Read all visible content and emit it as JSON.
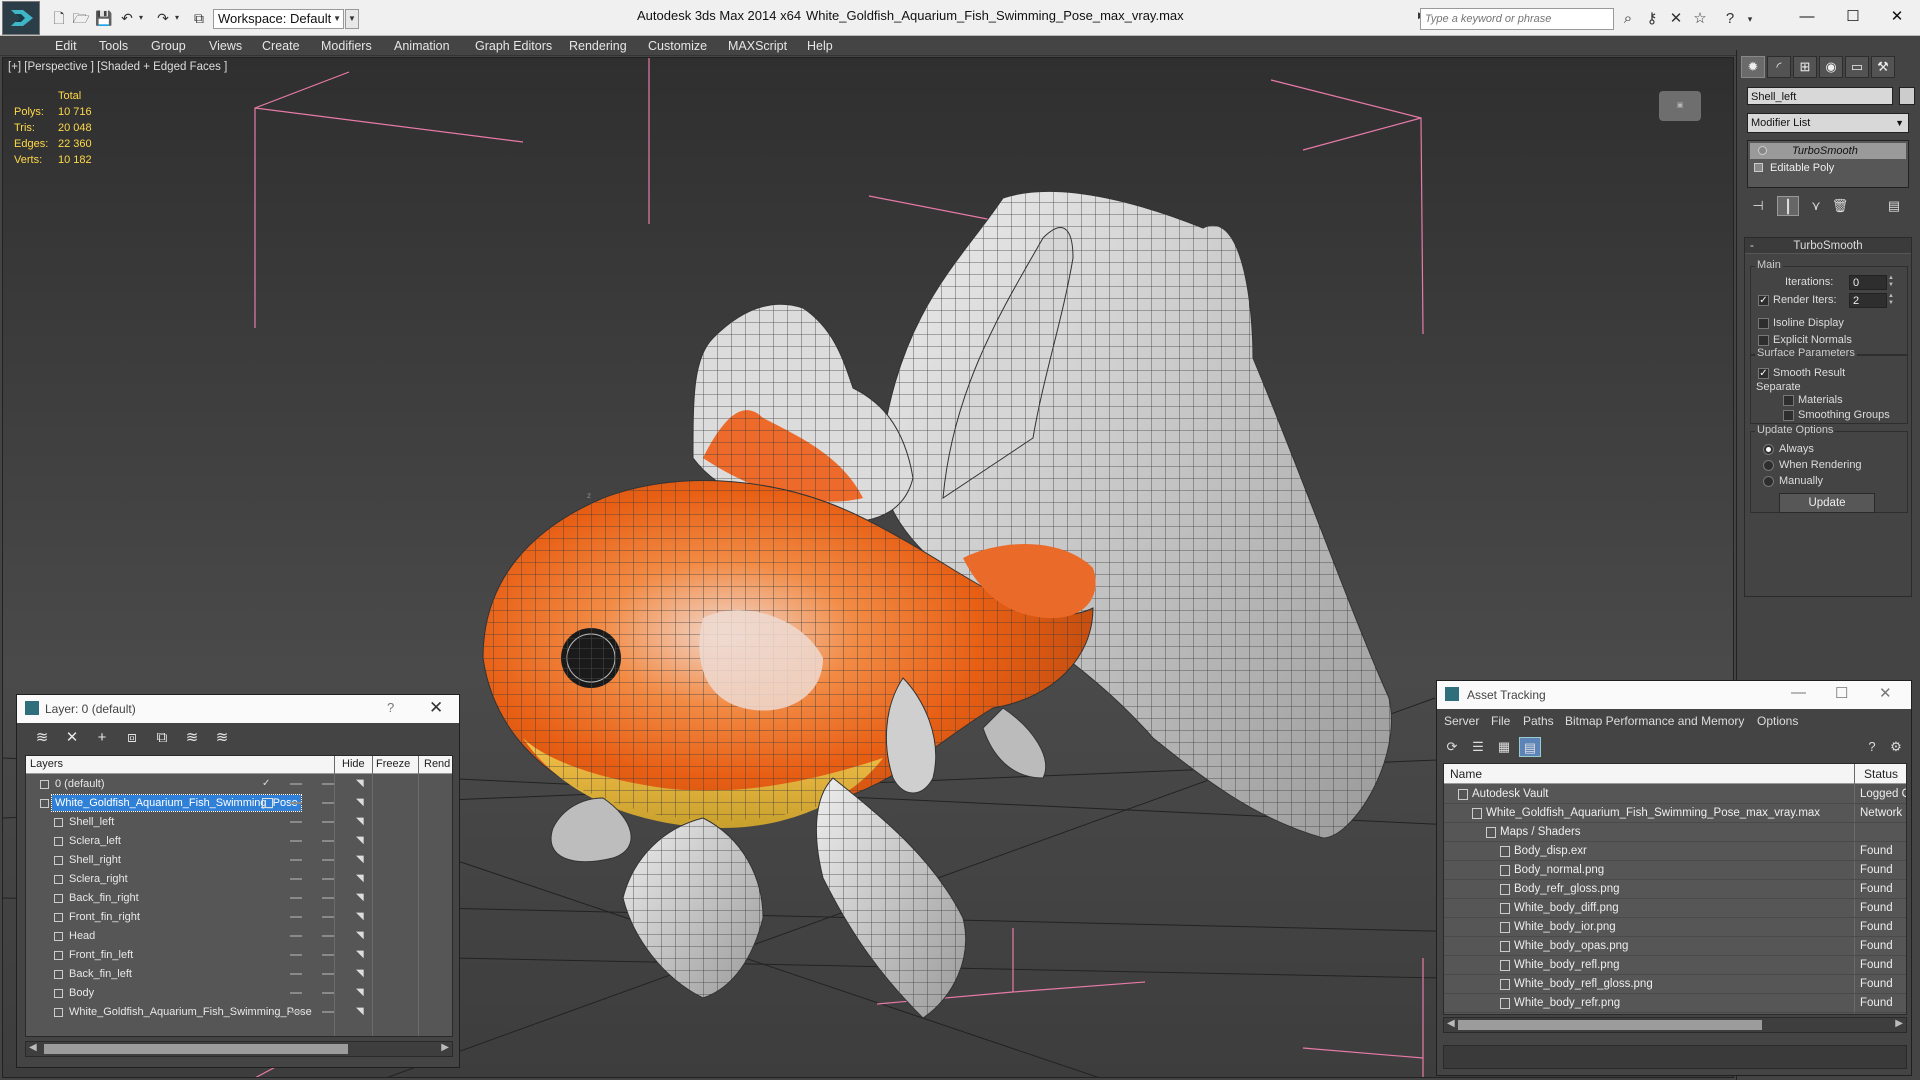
{
  "titlebar": {
    "workspace": "Workspace: Default",
    "app_title": "Autodesk 3ds Max  2014 x64",
    "file_title": "White_Goldfish_Aquarium_Fish_Swimming_Pose_max_vray.max",
    "search_placeholder": "Type a keyword or phrase"
  },
  "menu": [
    "Edit",
    "Tools",
    "Group",
    "Views",
    "Create",
    "Modifiers",
    "Animation",
    "Graph Editors",
    "Rendering",
    "Customize",
    "MAXScript",
    "Help"
  ],
  "viewport": {
    "label": "[+] [Perspective ] [Shaded + Edged Faces ]",
    "stats": {
      "total_label": "Total",
      "rows": [
        {
          "label": "Polys:",
          "value": "10 716"
        },
        {
          "label": "Tris:",
          "value": "20 048"
        },
        {
          "label": "Edges:",
          "value": "22 360"
        },
        {
          "label": "Verts:",
          "value": "10 182"
        }
      ]
    }
  },
  "command_panel": {
    "object_name": "Shell_left",
    "modifier_list": "Modifier List",
    "stack": [
      "TurboSmooth",
      "Editable Poly"
    ],
    "rollout_title": "TurboSmooth",
    "main_label": "Main",
    "iterations_label": "Iterations:",
    "iterations_value": "0",
    "render_iters_label": "Render Iters:",
    "render_iters_value": "2",
    "isoline_label": "Isoline Display",
    "explicit_normals_label": "Explicit Normals",
    "surface_params_label": "Surface Parameters",
    "smooth_result_label": "Smooth Result",
    "separate_label": "Separate",
    "materials_label": "Materials",
    "smoothing_groups_label": "Smoothing Groups",
    "update_options_label": "Update Options",
    "always_label": "Always",
    "when_rendering_label": "When Rendering",
    "manually_label": "Manually",
    "update_button": "Update"
  },
  "layer_dialog": {
    "title": "Layer: 0 (default)",
    "help": "?",
    "columns": {
      "layers": "Layers",
      "hide": "Hide",
      "freeze": "Freeze",
      "render": "Rend"
    },
    "rows": [
      {
        "name": "0 (default)",
        "indent": 0,
        "kind": "layer"
      },
      {
        "name": "White_Goldfish_Aquarium_Fish_Swimming_Pose",
        "indent": 0,
        "kind": "layer",
        "selected": true
      },
      {
        "name": "Shell_left",
        "indent": 1,
        "kind": "object"
      },
      {
        "name": "Sclera_left",
        "indent": 1,
        "kind": "object"
      },
      {
        "name": "Shell_right",
        "indent": 1,
        "kind": "object"
      },
      {
        "name": "Sclera_right",
        "indent": 1,
        "kind": "object"
      },
      {
        "name": "Back_fin_right",
        "indent": 1,
        "kind": "object"
      },
      {
        "name": "Front_fin_right",
        "indent": 1,
        "kind": "object"
      },
      {
        "name": "Head",
        "indent": 1,
        "kind": "object"
      },
      {
        "name": "Front_fin_left",
        "indent": 1,
        "kind": "object"
      },
      {
        "name": "Back_fin_left",
        "indent": 1,
        "kind": "object"
      },
      {
        "name": "Body",
        "indent": 1,
        "kind": "object"
      },
      {
        "name": "White_Goldfish_Aquarium_Fish_Swimming_Pose",
        "indent": 1,
        "kind": "object"
      }
    ]
  },
  "asset_dialog": {
    "title": "Asset Tracking",
    "menu": [
      "Server",
      "File",
      "Paths",
      "Bitmap Performance and Memory",
      "Options"
    ],
    "columns": {
      "name": "Name",
      "status": "Status"
    },
    "rows": [
      {
        "name": "Autodesk Vault",
        "status": "Logged Ou",
        "indent": 0
      },
      {
        "name": "White_Goldfish_Aquarium_Fish_Swimming_Pose_max_vray.max",
        "status": "Network P",
        "indent": 1
      },
      {
        "name": "Maps / Shaders",
        "status": "",
        "indent": 2
      },
      {
        "name": "Body_disp.exr",
        "status": "Found",
        "indent": 3
      },
      {
        "name": "Body_normal.png",
        "status": "Found",
        "indent": 3
      },
      {
        "name": "Body_refr_gloss.png",
        "status": "Found",
        "indent": 3
      },
      {
        "name": "White_body_diff.png",
        "status": "Found",
        "indent": 3
      },
      {
        "name": "White_body_ior.png",
        "status": "Found",
        "indent": 3
      },
      {
        "name": "White_body_opas.png",
        "status": "Found",
        "indent": 3
      },
      {
        "name": "White_body_refl.png",
        "status": "Found",
        "indent": 3
      },
      {
        "name": "White_body_refl_gloss.png",
        "status": "Found",
        "indent": 3
      },
      {
        "name": "White_body_refr.png",
        "status": "Found",
        "indent": 3
      }
    ]
  },
  "colors": {
    "stats_text": "#ffd84a",
    "selection": "#2f80d6",
    "bbox_lines": "#e87aa8",
    "fish_orange": "#f26a1b"
  }
}
